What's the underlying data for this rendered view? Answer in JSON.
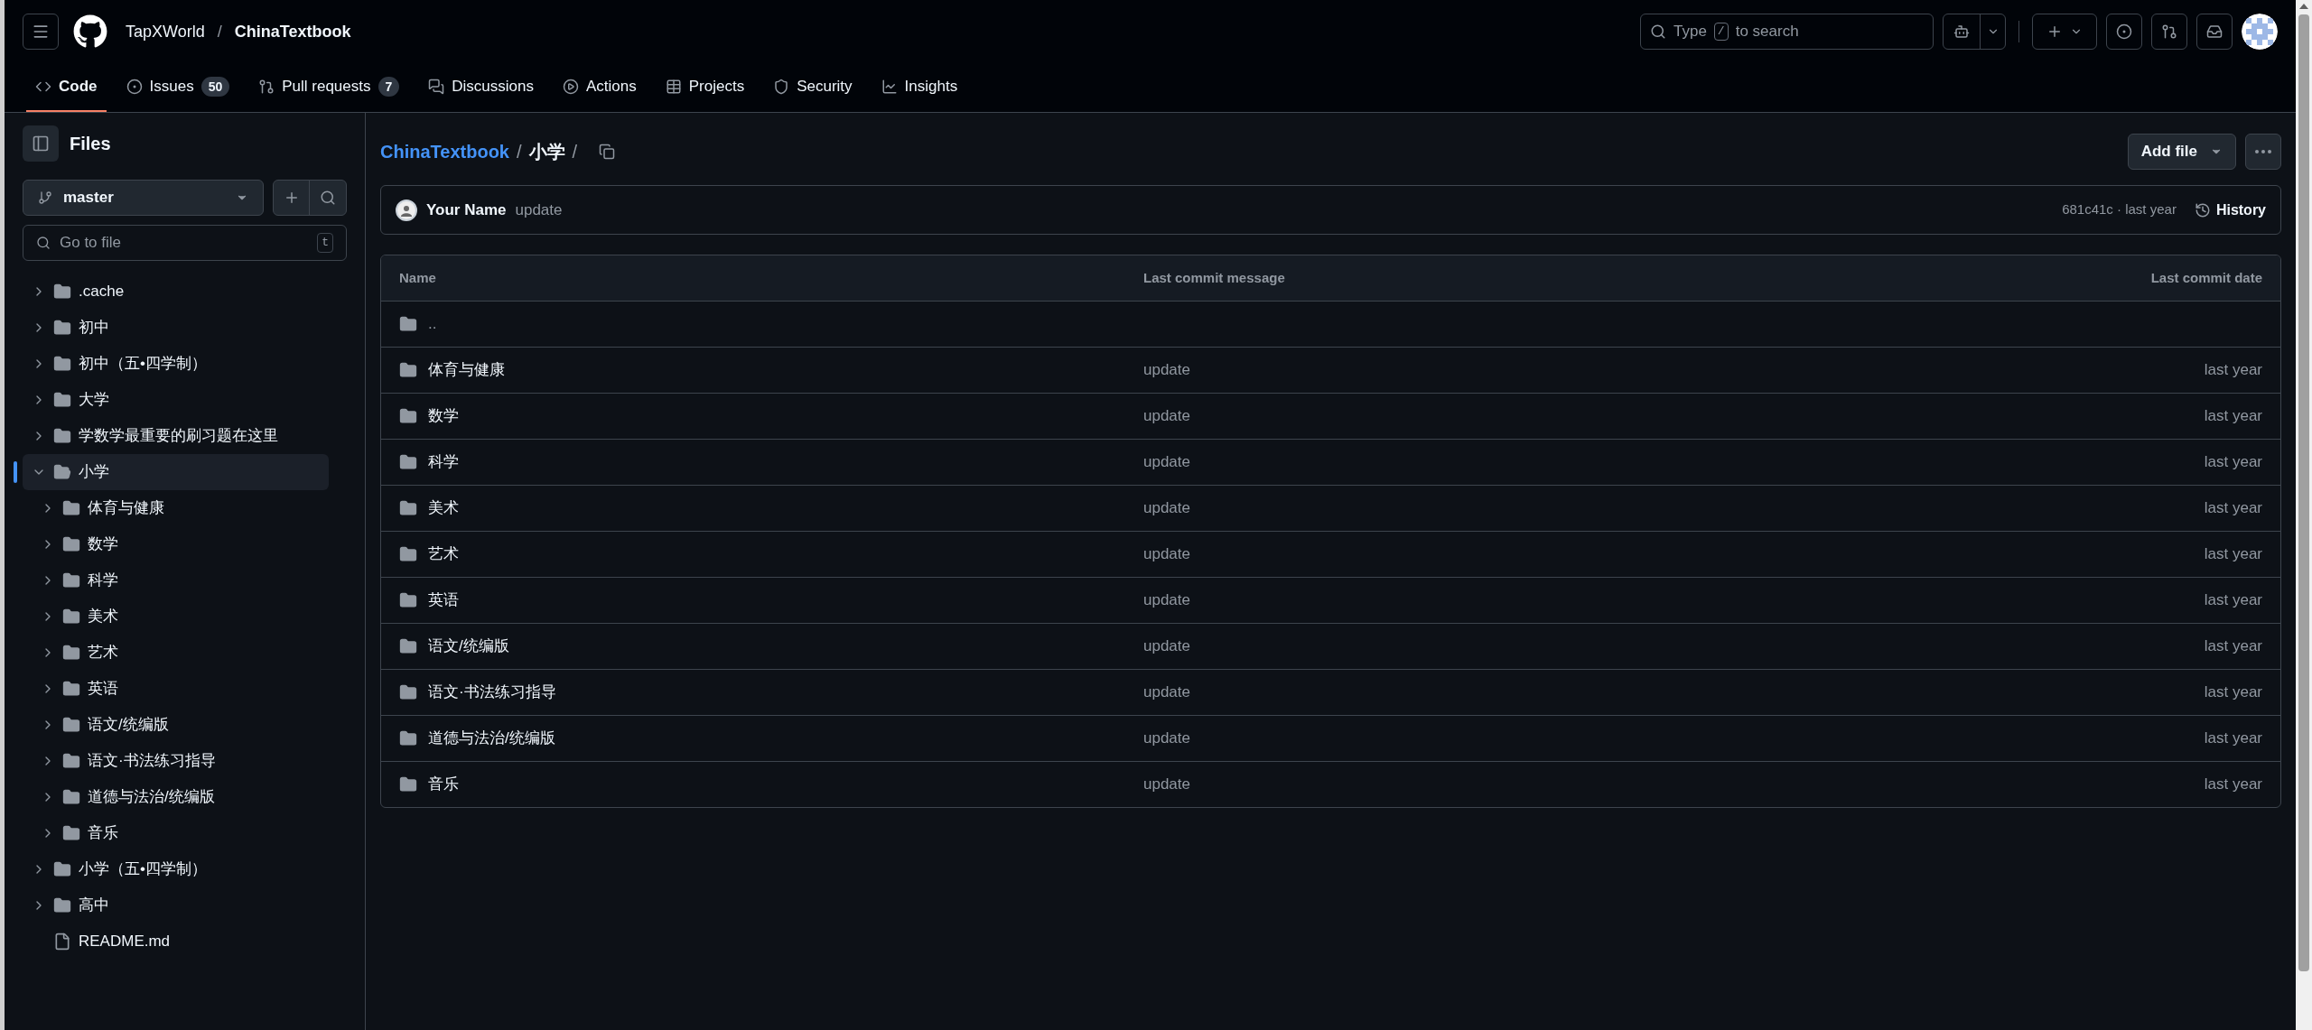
{
  "header": {
    "owner": "TapXWorld",
    "separator": "/",
    "repo": "ChinaTextbook",
    "search": {
      "prefix": "Type",
      "key": "/",
      "suffix": "to search"
    }
  },
  "tabs": [
    {
      "label": "Code",
      "selected": true,
      "kind": "code"
    },
    {
      "label": "Issues",
      "count": "50",
      "selected": false,
      "kind": "issues"
    },
    {
      "label": "Pull requests",
      "count": "7",
      "selected": false,
      "kind": "pulls"
    },
    {
      "label": "Discussions",
      "selected": false,
      "kind": "discussions"
    },
    {
      "label": "Actions",
      "selected": false,
      "kind": "actions"
    },
    {
      "label": "Projects",
      "selected": false,
      "kind": "projects"
    },
    {
      "label": "Security",
      "selected": false,
      "kind": "security"
    },
    {
      "label": "Insights",
      "selected": false,
      "kind": "insights"
    }
  ],
  "sidebar": {
    "title": "Files",
    "branch": "master",
    "filter": {
      "placeholder": "Go to file",
      "shortcut": "t"
    },
    "tree": [
      {
        "name": ".cache",
        "kind": "folder",
        "expanded": false,
        "selected": false
      },
      {
        "name": "初中",
        "kind": "folder",
        "expanded": false,
        "selected": false
      },
      {
        "name": "初中（五•四学制）",
        "kind": "folder",
        "expanded": false,
        "selected": false
      },
      {
        "name": "大学",
        "kind": "folder",
        "expanded": false,
        "selected": false
      },
      {
        "name": "学数学最重要的刷习题在这里",
        "kind": "folder",
        "expanded": false,
        "selected": false
      },
      {
        "name": "小学",
        "kind": "folder",
        "expanded": true,
        "selected": true,
        "children": [
          {
            "name": "体育与健康",
            "kind": "folder",
            "expanded": false,
            "selected": false
          },
          {
            "name": "数学",
            "kind": "folder",
            "expanded": false,
            "selected": false
          },
          {
            "name": "科学",
            "kind": "folder",
            "expanded": false,
            "selected": false
          },
          {
            "name": "美术",
            "kind": "folder",
            "expanded": false,
            "selected": false
          },
          {
            "name": "艺术",
            "kind": "folder",
            "expanded": false,
            "selected": false
          },
          {
            "name": "英语",
            "kind": "folder",
            "expanded": false,
            "selected": false
          },
          {
            "name": "语文/统编版",
            "kind": "folder",
            "expanded": false,
            "selected": false
          },
          {
            "name": "语文·书法练习指导",
            "kind": "folder",
            "expanded": false,
            "selected": false
          },
          {
            "name": "道德与法治/统编版",
            "kind": "folder",
            "expanded": false,
            "selected": false
          },
          {
            "name": "音乐",
            "kind": "folder",
            "expanded": false,
            "selected": false
          }
        ]
      },
      {
        "name": "小学（五•四学制）",
        "kind": "folder",
        "expanded": false,
        "selected": false
      },
      {
        "name": "高中",
        "kind": "folder",
        "expanded": false,
        "selected": false
      },
      {
        "name": "README.md",
        "kind": "file",
        "selected": false
      }
    ]
  },
  "main": {
    "breadcrumb": [
      {
        "label": "ChinaTextbook",
        "separator": "/",
        "kind": "link"
      },
      {
        "label": "小学",
        "separator": "/",
        "kind": "current"
      }
    ],
    "add_file": "Add file",
    "commit": {
      "author": "Your Name",
      "message": "update",
      "meta": "681c41c · last year",
      "history": "History"
    },
    "table": {
      "columns": [
        "Name",
        "Last commit message",
        "Last commit date"
      ],
      "rows": [
        {
          "name": "..",
          "kind": "parent"
        },
        {
          "name": "体育与健康",
          "message": "update",
          "date": "last year",
          "kind": "folder"
        },
        {
          "name": "数学",
          "message": "update",
          "date": "last year",
          "kind": "folder"
        },
        {
          "name": "科学",
          "message": "update",
          "date": "last year",
          "kind": "folder"
        },
        {
          "name": "美术",
          "message": "update",
          "date": "last year",
          "kind": "folder"
        },
        {
          "name": "艺术",
          "message": "update",
          "date": "last year",
          "kind": "folder"
        },
        {
          "name": "英语",
          "message": "update",
          "date": "last year",
          "kind": "folder"
        },
        {
          "name": "语文/统编版",
          "message": "update",
          "date": "last year",
          "kind": "folder"
        },
        {
          "name": "语文·书法练习指导",
          "message": "update",
          "date": "last year",
          "kind": "folder"
        },
        {
          "name": "道德与法治/统编版",
          "message": "update",
          "date": "last year",
          "kind": "folder"
        },
        {
          "name": "音乐",
          "message": "update",
          "date": "last year",
          "kind": "folder"
        }
      ]
    }
  }
}
